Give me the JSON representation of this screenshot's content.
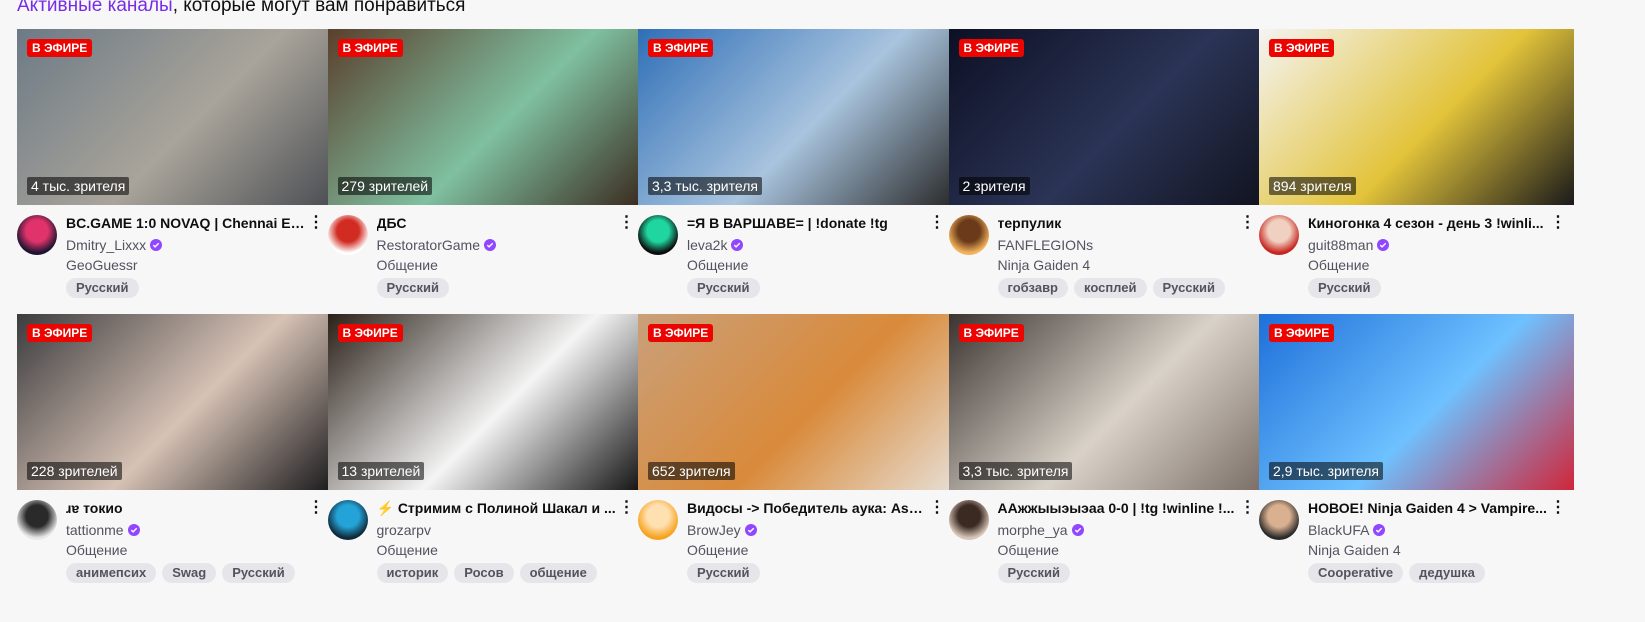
{
  "heading": {
    "link": "Активные каналы",
    "rest": ", которые могут вам понравиться"
  },
  "live_label": "В ЭФИРЕ",
  "colors": {
    "live": "#eb0400",
    "accent": "#772ce8",
    "verified": "#9146ff"
  },
  "cards": [
    {
      "viewers": "4 тыс. зрителя",
      "title": "BC.GAME 1:0 NOVAQ | Chennai Es...",
      "channel": "Dmitry_Lixxx",
      "verified": true,
      "category": "GeoGuessr",
      "tags": [
        "Русский"
      ],
      "thumb": [
        "#6c7a86",
        "#a9a49a",
        "#4c4f54"
      ],
      "avatar": [
        "#1c1430",
        "#e0336b"
      ]
    },
    {
      "viewers": "279 зрителей",
      "title": "ДБС",
      "channel": "RestoratorGame",
      "verified": true,
      "category": "Общение",
      "tags": [
        "Русский"
      ],
      "thumb": [
        "#5a3f2c",
        "#7fc0a0",
        "#3a2a1f"
      ],
      "avatar": [
        "#ffffff",
        "#d12b22"
      ]
    },
    {
      "viewers": "3,3 тыс. зрителя",
      "title": "=Я В ВАРШАВЕ= | !donate !tg",
      "channel": "leva2k",
      "verified": true,
      "category": "Общение",
      "tags": [
        "Русский"
      ],
      "thumb": [
        "#2f6fb7",
        "#a8c4de",
        "#2b2b2b"
      ],
      "avatar": [
        "#0b0b0b",
        "#20d6a0"
      ]
    },
    {
      "viewers": "2 зрителя",
      "title": "терпулик",
      "channel": "FANFLEGIONs",
      "verified": false,
      "category": "Ninja Gaiden 4",
      "tags": [
        "гобзавр",
        "косплей",
        "Русский"
      ],
      "thumb": [
        "#0d1024",
        "#2b3456",
        "#11131f"
      ],
      "avatar": [
        "#f2b35c",
        "#6a3a1a"
      ]
    },
    {
      "viewers": "894 зрителя",
      "title": "Киногонка 4 сезон - день 3 !winli...",
      "channel": "guit88man",
      "verified": true,
      "category": "Общение",
      "tags": [
        "Русский"
      ],
      "thumb": [
        "#f4f4f4",
        "#e2c33a",
        "#1a1a1a"
      ],
      "avatar": [
        "#c7261f",
        "#f0d0c0"
      ]
    },
    {
      "viewers": "228 зрителей",
      "title": "ɹɐ токио",
      "channel": "tattionme",
      "verified": true,
      "category": "Общение",
      "tags": [
        "анимепсих",
        "Swag",
        "Русский"
      ],
      "thumb": [
        "#3b3b3e",
        "#d7c2b5",
        "#1b1b1d"
      ],
      "avatar": [
        "#e8e8e8",
        "#2a2a2a"
      ]
    },
    {
      "viewers": "13 зрителей",
      "title": "⚡ Стримим с Полиной Шакал и ...",
      "channel": "grozarpv",
      "verified": false,
      "category": "Общение",
      "tags": [
        "историк",
        "Росов",
        "общение"
      ],
      "thumb": [
        "#2a2018",
        "#f4f4f4",
        "#111111"
      ],
      "avatar": [
        "#0f2a3a",
        "#24a3d8"
      ]
    },
    {
      "viewers": "652 зрителя",
      "title": "Видосы -> Победитель аука: Ass...",
      "channel": "BrowJey",
      "verified": true,
      "category": "Общение",
      "tags": [
        "Русский"
      ],
      "thumb": [
        "#c9a07a",
        "#d98a3a",
        "#e6ddd2"
      ],
      "avatar": [
        "#f6a21c",
        "#ffe0b0"
      ]
    },
    {
      "viewers": "3,3 тыс. зрителя",
      "title": "ААжжыыэыэаа 0-0 | !tg !winline !...",
      "channel": "morphe_ya",
      "verified": true,
      "category": "Общение",
      "tags": [
        "Русский"
      ],
      "thumb": [
        "#3a3330",
        "#d9d2c8",
        "#7a6e66"
      ],
      "avatar": [
        "#d8c5b8",
        "#3a2a22"
      ]
    },
    {
      "viewers": "2,9 тыс. зрителя",
      "title": "НОВОЕ! Ninja Gaiden 4 > Vampire...",
      "channel": "BlackUFA",
      "verified": true,
      "category": "Ninja Gaiden 4",
      "tags": [
        "Cooperative",
        "дедушка"
      ],
      "thumb": [
        "#1e6fd9",
        "#6ec1ff",
        "#d0263a"
      ],
      "avatar": [
        "#2a2a2a",
        "#d9b090"
      ]
    }
  ]
}
